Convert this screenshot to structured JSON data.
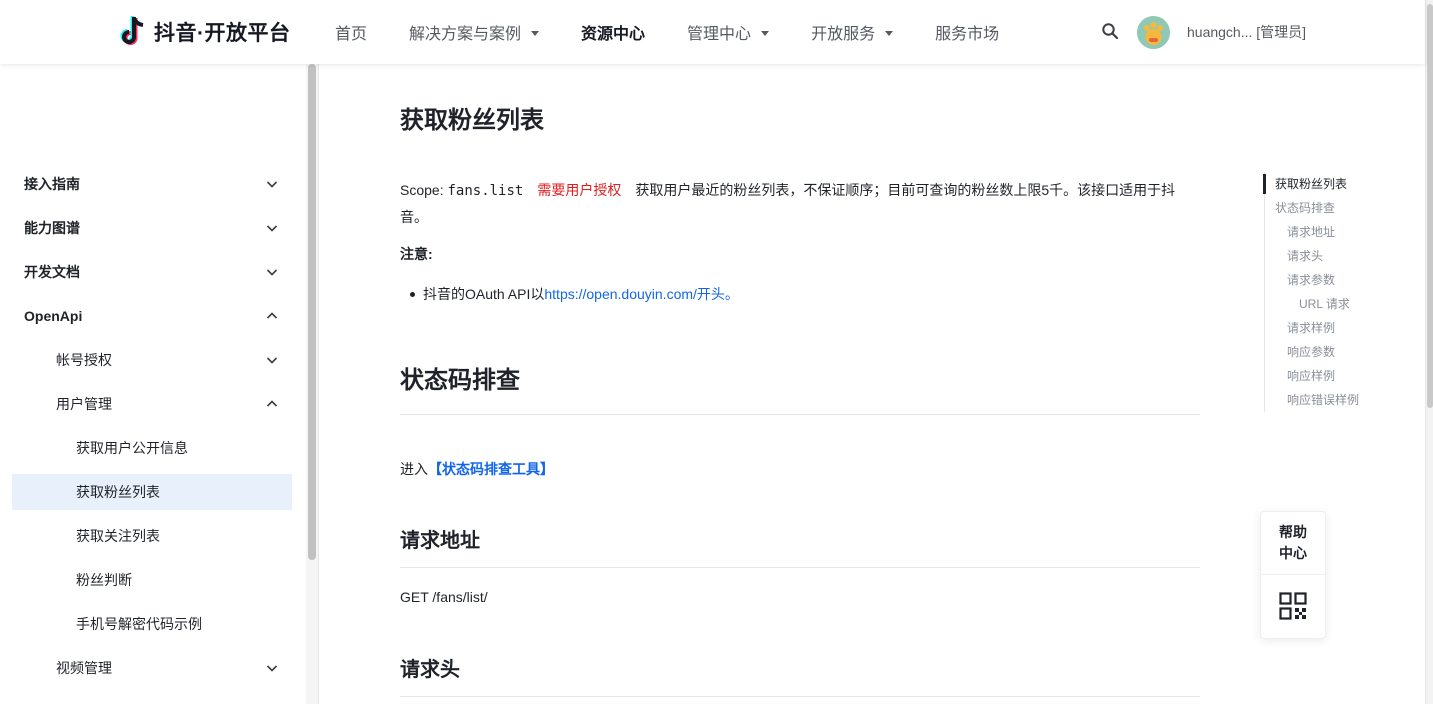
{
  "header": {
    "logo_text": "抖音·开放平台",
    "nav": [
      {
        "label": "首页",
        "dropdown": false,
        "active": false
      },
      {
        "label": "解决方案与案例",
        "dropdown": true,
        "active": false
      },
      {
        "label": "资源中心",
        "dropdown": false,
        "active": true
      },
      {
        "label": "管理中心",
        "dropdown": true,
        "active": false
      },
      {
        "label": "开放服务",
        "dropdown": true,
        "active": false
      },
      {
        "label": "服务市场",
        "dropdown": false,
        "active": false
      }
    ],
    "search_icon": "search-icon",
    "user_name": "huangch... [管理员]"
  },
  "sidebar": {
    "items": [
      {
        "label": "接入指南",
        "level": 0,
        "expanded": false
      },
      {
        "label": "能力图谱",
        "level": 0,
        "expanded": false
      },
      {
        "label": "开发文档",
        "level": 0,
        "expanded": false
      },
      {
        "label": "OpenApi",
        "level": 0,
        "expanded": true
      },
      {
        "label": "帐号授权",
        "level": 1,
        "expanded": false
      },
      {
        "label": "用户管理",
        "level": 1,
        "expanded": true
      },
      {
        "label": "获取用户公开信息",
        "level": 2
      },
      {
        "label": "获取粉丝列表",
        "level": 2,
        "selected": true
      },
      {
        "label": "获取关注列表",
        "level": 2
      },
      {
        "label": "粉丝判断",
        "level": 2
      },
      {
        "label": "手机号解密代码示例",
        "level": 2
      },
      {
        "label": "视频管理",
        "level": 1,
        "expanded": false
      }
    ]
  },
  "main": {
    "title": "获取粉丝列表",
    "scope_prefix": "Scope: ",
    "scope_code": "fans.list",
    "auth_badge": "需要用户授权",
    "scope_desc": "获取用户最近的粉丝列表，不保证顺序；目前可查询的粉丝数上限5千。该接口适用于抖音。",
    "note_label": "注意:",
    "bullet_prefix": "抖音的OAuth API以",
    "bullet_link": "https://open.douyin.com/",
    "bullet_suffix": "开头。",
    "status_title": "状态码排查",
    "status_prefix": "进入",
    "status_link": "【状态码排查工具】",
    "request_url_title": "请求地址",
    "request_url": "GET /fans/list/",
    "request_header_title": "请求头"
  },
  "toc": {
    "items": [
      {
        "label": "获取粉丝列表",
        "level": 0,
        "active": true
      },
      {
        "label": "状态码排查",
        "level": 0
      },
      {
        "label": "请求地址",
        "level": 1
      },
      {
        "label": "请求头",
        "level": 1
      },
      {
        "label": "请求参数",
        "level": 1
      },
      {
        "label": "URL 请求",
        "level": 2
      },
      {
        "label": "请求样例",
        "level": 1
      },
      {
        "label": "响应参数",
        "level": 1
      },
      {
        "label": "响应样例",
        "level": 1
      },
      {
        "label": "响应错误样例",
        "level": 1
      }
    ]
  },
  "float": {
    "help_line1": "帮助",
    "help_line2": "中心",
    "qr_icon": "qr-code-icon"
  },
  "colors": {
    "link": "#1366ec",
    "auth_red": "#e02020",
    "selected_bg": "#e8f1fb",
    "text": "#1f2329"
  }
}
